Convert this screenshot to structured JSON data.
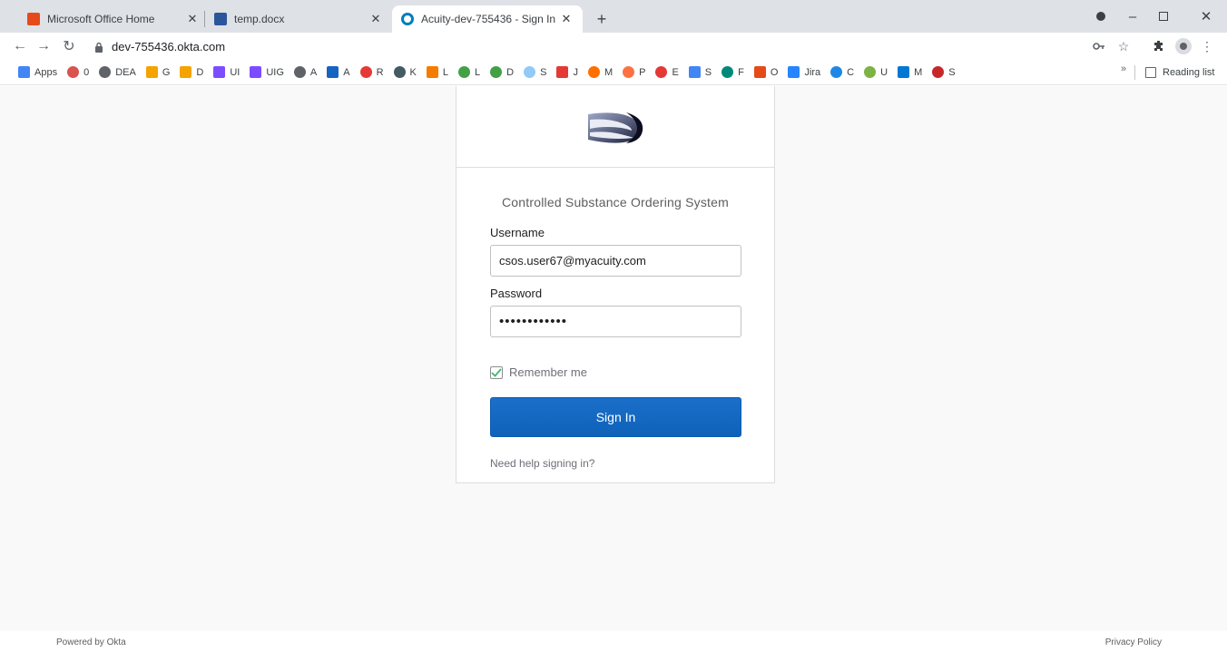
{
  "browser": {
    "tabs": [
      {
        "title": "Microsoft Office Home",
        "icon": "office-icon",
        "color": "#e64a19"
      },
      {
        "title": "temp.docx",
        "icon": "word-icon",
        "color": "#2b579a"
      },
      {
        "title": "Acuity-dev-755436 - Sign In",
        "icon": "okta-icon",
        "color": "#007dc1",
        "active": true
      }
    ],
    "new_tab": "+",
    "url": "dev-755436.okta.com",
    "bookmarks": [
      {
        "label": "Apps",
        "icon": "apps-grid-icon",
        "color": "#4285f4"
      },
      {
        "label": "0",
        "icon": "bookmark-icon",
        "color": "#d9534f"
      },
      {
        "label": "DEA",
        "icon": "globe-icon",
        "color": "#5f6368"
      },
      {
        "label": "G",
        "icon": "cube-icon",
        "color": "#f4a300"
      },
      {
        "label": "D",
        "icon": "cube-icon",
        "color": "#f4a300"
      },
      {
        "label": "UI",
        "icon": "figma-icon",
        "color": "#7c4dff"
      },
      {
        "label": "UIG",
        "icon": "figma-icon",
        "color": "#7c4dff"
      },
      {
        "label": "A",
        "icon": "globe-icon",
        "color": "#5f6368"
      },
      {
        "label": "A",
        "icon": "ssa-icon",
        "color": "#1565c0"
      },
      {
        "label": "R",
        "icon": "bookmark-icon",
        "color": "#e53935"
      },
      {
        "label": "K",
        "icon": "bookmark-icon",
        "color": "#455a64"
      },
      {
        "label": "L",
        "icon": "cube-icon",
        "color": "#f57c00"
      },
      {
        "label": "L",
        "icon": "bookmark-icon",
        "color": "#43a047"
      },
      {
        "label": "D",
        "icon": "bookmark-icon",
        "color": "#43a047"
      },
      {
        "label": "S",
        "icon": "bookmark-icon",
        "color": "#90caf9"
      },
      {
        "label": "J",
        "icon": "youtube-icon",
        "color": "#e53935"
      },
      {
        "label": "M",
        "icon": "bookmark-icon",
        "color": "#ff6f00"
      },
      {
        "label": "P",
        "icon": "bookmark-icon",
        "color": "#ff7043"
      },
      {
        "label": "E",
        "icon": "bookmark-icon",
        "color": "#e53935"
      },
      {
        "label": "S",
        "icon": "google-icon",
        "color": "#4285f4"
      },
      {
        "label": "F",
        "icon": "bookmark-icon",
        "color": "#00897b"
      },
      {
        "label": "O",
        "icon": "office-icon",
        "color": "#e64a19"
      },
      {
        "label": "Jira",
        "icon": "jira-icon",
        "color": "#2684ff"
      },
      {
        "label": "C",
        "icon": "bookmark-icon",
        "color": "#1e88e5"
      },
      {
        "label": "U",
        "icon": "bookmark-icon",
        "color": "#7cb342"
      },
      {
        "label": "M",
        "icon": "outlook-icon",
        "color": "#0078d4"
      },
      {
        "label": "S",
        "icon": "bookmark-icon",
        "color": "#c62828"
      }
    ],
    "bookmarks_more": "»",
    "reading_list": "Reading list"
  },
  "login": {
    "title": "Controlled Substance Ordering System",
    "username_label": "Username",
    "username_value": "csos.user67@myacuity.com",
    "password_label": "Password",
    "password_value": "••••••••••••",
    "remember_label": "Remember me",
    "remember_checked": true,
    "signin_label": "Sign In",
    "help_link": "Need help signing in?"
  },
  "footer": {
    "powered_by": "Powered by Okta",
    "privacy": "Privacy Policy"
  }
}
